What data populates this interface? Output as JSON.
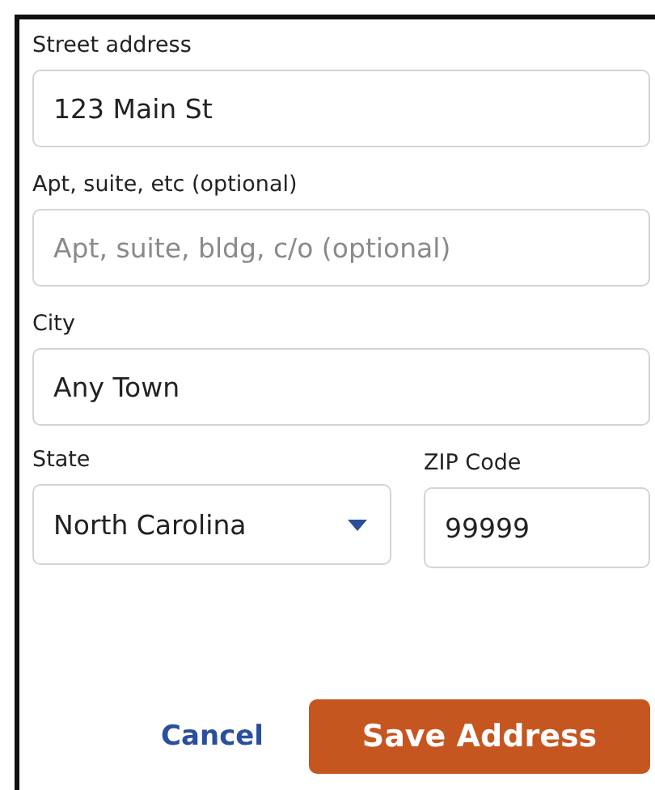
{
  "fields": [
    {
      "label": "Street address",
      "value": "123 Main St"
    },
    {
      "label": "Apt, suite, etc (optional)",
      "placeholder": "Apt, suite, bldg, c/o (optional)"
    },
    {
      "label": "City",
      "value": "Any Town"
    }
  ],
  "state": {
    "label": "State",
    "value": "North Carolina"
  },
  "zip": {
    "label": "ZIP Code",
    "value": "99999"
  },
  "buttons": {
    "cancel": "Cancel",
    "save": "Save Address"
  }
}
